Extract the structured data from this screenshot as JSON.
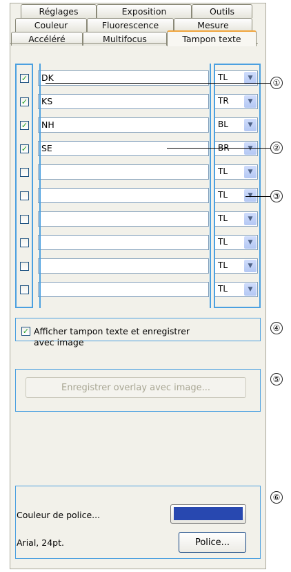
{
  "tabs": {
    "row1": [
      "Réglages",
      "Exposition",
      "Outils"
    ],
    "row2": [
      "Couleur",
      "Fluorescence",
      "Mesure"
    ],
    "row3": [
      "Accéléré",
      "Multifocus",
      "Tampon texte"
    ],
    "active": "Tampon texte"
  },
  "rows": [
    {
      "checked": true,
      "text": "DK",
      "pos": "TL"
    },
    {
      "checked": true,
      "text": "KS",
      "pos": "TR"
    },
    {
      "checked": true,
      "text": "NH",
      "pos": "BL"
    },
    {
      "checked": true,
      "text": "SE",
      "pos": "BR"
    },
    {
      "checked": false,
      "text": "",
      "pos": "TL"
    },
    {
      "checked": false,
      "text": "",
      "pos": "TL"
    },
    {
      "checked": false,
      "text": "",
      "pos": "TL"
    },
    {
      "checked": false,
      "text": "",
      "pos": "TL"
    },
    {
      "checked": false,
      "text": "",
      "pos": "TL"
    },
    {
      "checked": false,
      "text": "",
      "pos": "TL"
    }
  ],
  "show_stamp": {
    "checked": true,
    "label_line1": "Afficher tampon texte et enregistrer",
    "label_line2": "avec image"
  },
  "save_overlay_label": "Enregistrer overlay avec image...",
  "font_color_label": "Couleur de police...",
  "font_color": "#2848b0",
  "font_desc": "Arial, 24pt.",
  "font_button_label": "Police...",
  "callouts": [
    "①",
    "②",
    "③",
    "④",
    "⑤",
    "⑥"
  ],
  "checkmark": "✓",
  "dropdown_glyph": "▼"
}
